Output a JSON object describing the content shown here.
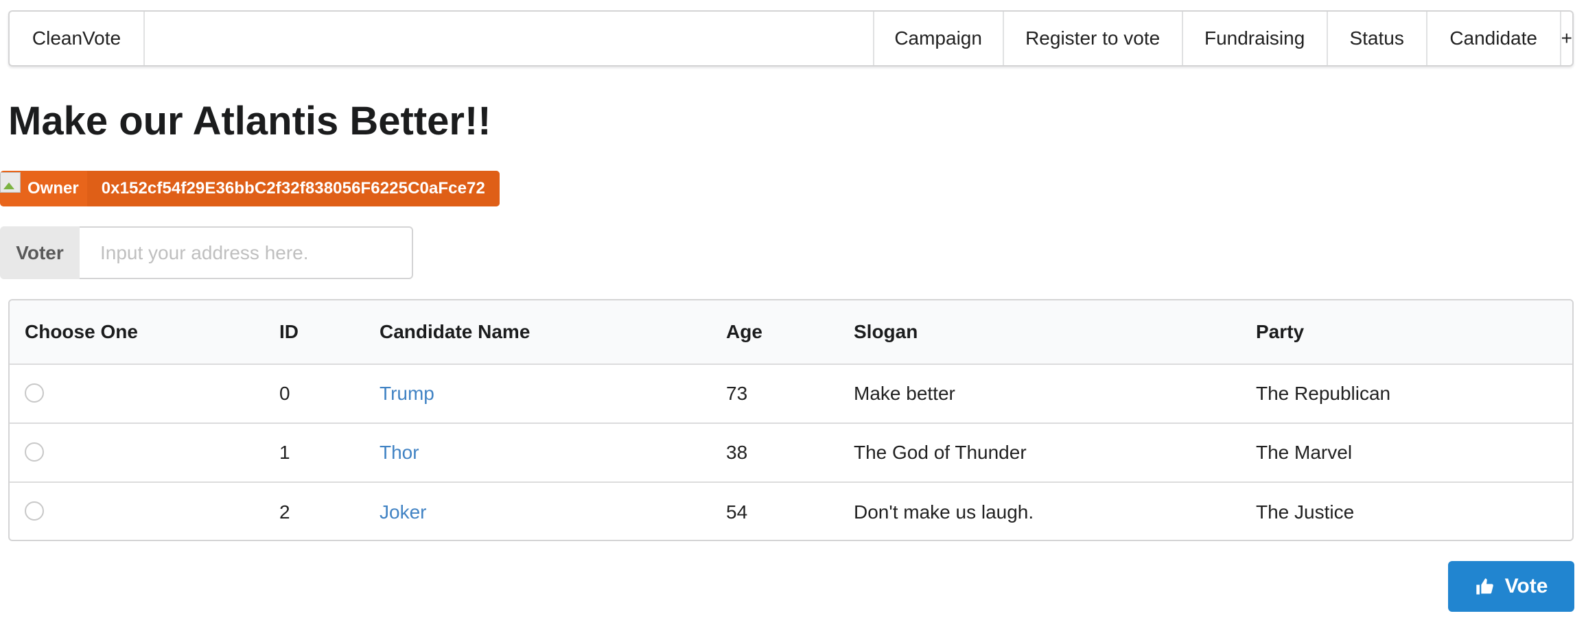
{
  "menu": {
    "brand": "CleanVote",
    "items": [
      {
        "label": "Campaign"
      },
      {
        "label": "Register to vote"
      },
      {
        "label": "Fundraising"
      },
      {
        "label": "Status"
      },
      {
        "label": "Candidate"
      },
      {
        "label": "+"
      }
    ]
  },
  "page": {
    "title": "Make our Atlantis Better!!"
  },
  "owner": {
    "label": "Owner",
    "address": "0x152cf54f29E36bbC2f32f838056F6225C0aFce72",
    "color": "#e8651b"
  },
  "voter": {
    "label": "Voter",
    "placeholder": "Input your address here.",
    "value": ""
  },
  "table": {
    "headers": [
      "Choose One",
      "ID",
      "Candidate Name",
      "Age",
      "Slogan",
      "Party"
    ],
    "rows": [
      {
        "id": "0",
        "name": "Trump",
        "age": "73",
        "slogan": "Make better",
        "party": "The Republican",
        "selected": false
      },
      {
        "id": "1",
        "name": "Thor",
        "age": "38",
        "slogan": "The God of Thunder",
        "party": "The Marvel",
        "selected": false
      },
      {
        "id": "2",
        "name": "Joker",
        "age": "54",
        "slogan": "Don't make us laugh.",
        "party": "The Justice",
        "selected": false
      }
    ]
  },
  "vote_button": {
    "label": "Vote",
    "icon": "thumbs-up-icon",
    "color": "#2185d0"
  },
  "colors": {
    "link": "#4183c4",
    "owner_bg": "#e8651b",
    "primary": "#2185d0"
  }
}
